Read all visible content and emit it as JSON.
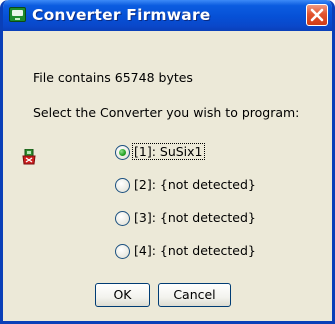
{
  "window": {
    "title": "Converter Firmware",
    "app_icon": "converter-app-icon",
    "close_icon": "close-icon",
    "colors": {
      "title_bar": "#0650d6",
      "body": "#ece9d8",
      "close": "#e2542f",
      "radio_dot": "#21a121"
    }
  },
  "dialog": {
    "file_info": "File contains 65748 bytes",
    "prompt": "Select the Converter you wish to program:",
    "chip_icon": "chip-icon",
    "options": [
      {
        "label": "[1]:  SuSix1",
        "selected": true
      },
      {
        "label": "[2]: {not detected}",
        "selected": false
      },
      {
        "label": "[3]: {not detected}",
        "selected": false
      },
      {
        "label": "[4]: {not detected}",
        "selected": false
      }
    ],
    "ok_label": "OK",
    "cancel_label": "Cancel"
  }
}
